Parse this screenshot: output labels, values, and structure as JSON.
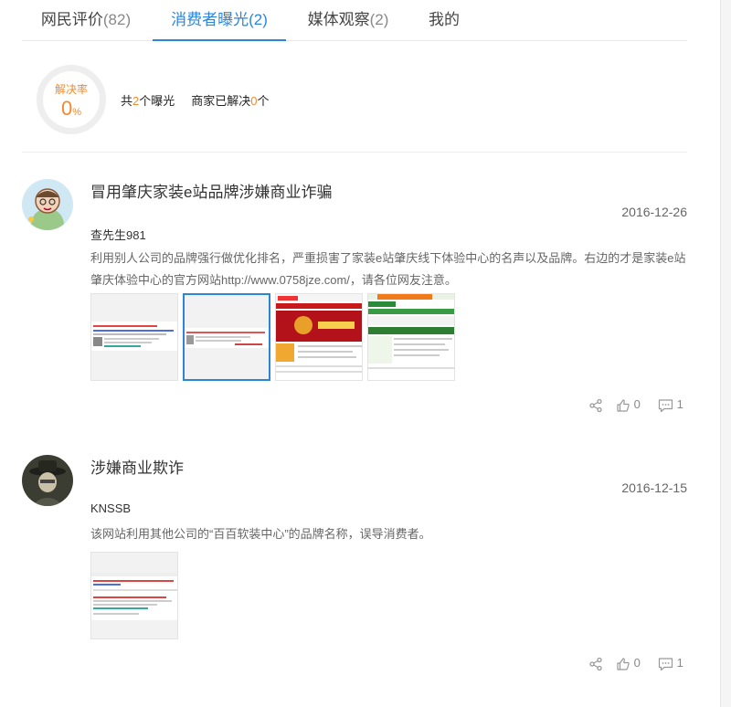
{
  "tabs": [
    {
      "label": "网民评价",
      "count": "(82)"
    },
    {
      "label": "消费者曝光",
      "count": "(2)"
    },
    {
      "label": "媒体观察",
      "count": "(2)"
    },
    {
      "label": "我的",
      "count": ""
    }
  ],
  "summary": {
    "rate_label": "解决率",
    "rate_value": "0",
    "rate_unit": "%",
    "total_prefix": "共",
    "total_count": "2",
    "total_suffix": "个曝光",
    "solved_prefix": "商家已解决",
    "solved_count": "0",
    "solved_suffix": "个"
  },
  "posts": [
    {
      "title": "冒用肇庆家装e站品牌涉嫌商业诈骗",
      "date": "2016-12-26",
      "user": "查先生981",
      "body": "利用别人公司的品牌强行做优化排名，严重损害了家装e站肇庆线下体验中心的名声以及品牌。右边的才是家装e站肇庆体验中心的官方网站http://www.0758jze.com/，请各位网友注意。",
      "likes": "0",
      "comments": "1"
    },
    {
      "title": "涉嫌商业欺诈",
      "date": "2016-12-15",
      "user": "KNSSB",
      "body": "该网站利用其他公司的“百百软装中心”的品牌名称，误导消费者。",
      "likes": "0",
      "comments": "1"
    }
  ],
  "colors": {
    "accent": "#2b86d9",
    "highlight": "#f08a2c"
  }
}
